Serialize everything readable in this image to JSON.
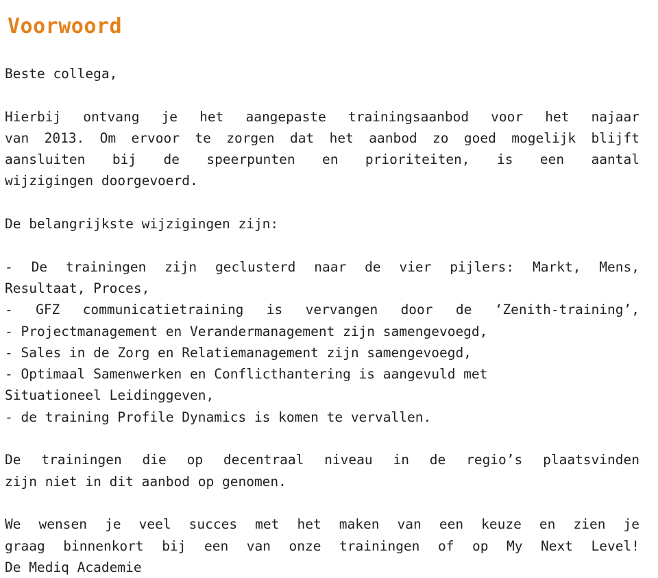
{
  "document": {
    "title": "Voorwoord",
    "title_color": "#e3821c",
    "text_color": "#231f20",
    "background_color": "#ffffff",
    "language": "nl"
  },
  "content": {
    "salutation": "Beste collega,",
    "intro_paragraph": {
      "lines": [
        "Hierbij ontvang je het aangepaste trainingsaanbod voor het najaar",
        "van 2013. Om ervoor te zorgen dat het aanbod zo goed mogelijk blijft",
        "aansluiten bij de speerpunten en prioriteiten, is een aantal",
        "wijzigingen doorgevoerd."
      ],
      "full_text": "Hierbij ontvang je het aangepaste trainingsaanbod voor het najaar van 2013. Om ervoor te zorgen dat het aanbod zo goed mogelijk blijft aansluiten bij de speerpunten en prioriteiten, is een aantal wijzigingen doorgevoerd."
    },
    "changes_heading": "De belangrijkste wijzigingen zijn:",
    "changes_list": [
      {
        "line1": "- De trainingen zijn geclusterd naar de vier pijlers: Markt, Mens,",
        "line2": "Resultaat, Proces,"
      },
      {
        "line1": "- GFZ communicatietraining is vervangen door de ‘Zenith-training’,",
        "line2": ""
      },
      {
        "line1": "- Projectmanagement en Verandermanagement zijn samengevoegd,",
        "line2": ""
      },
      {
        "line1": "- Sales in de Zorg en Relatiemanagement zijn samengevoegd,",
        "line2": ""
      },
      {
        "line1": "- Optimaal Samenwerken en Conflicthantering is aangevuld met",
        "line2": "Situationeel Leidinggeven,"
      },
      {
        "line1": "- de training Profile Dynamics is komen te vervallen.",
        "line2": ""
      }
    ],
    "regions_paragraph": {
      "line1": "De trainingen die op decentraal niveau in de regio’s plaatsvinden",
      "line2": "zijn niet in dit aanbod op genomen.",
      "full_text": "De trainingen die op decentraal niveau in de regio’s plaatsvinden zijn niet in dit aanbod op genomen."
    },
    "closing_paragraph": {
      "line1": "We wensen je veel succes met het maken van een keuze en zien je",
      "line2": "graag binnenkort bij een van onze trainingen of op My Next Level!",
      "full_text": "We wensen je veel succes met het maken van een keuze en zien je graag binnenkort bij een van onze trainingen of op My Next Level!"
    },
    "signature": "De Mediq Academie"
  }
}
